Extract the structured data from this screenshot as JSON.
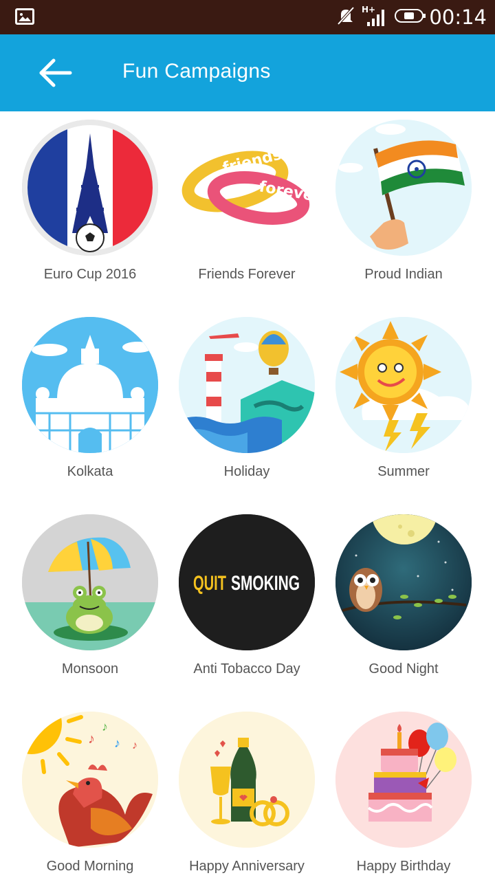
{
  "status_bar": {
    "time": "00:14",
    "network": "H+",
    "icons": [
      "gallery-icon",
      "muted-bell-icon",
      "signal-icon",
      "battery-icon"
    ]
  },
  "app_bar": {
    "title": "Fun Campaigns",
    "back_icon": "arrow-back-icon",
    "color": "#13a3dc"
  },
  "campaigns": [
    {
      "label": "Euro Cup 2016",
      "icon": "eiffel-flag-football-icon"
    },
    {
      "label": "Friends Forever",
      "icon": "friendship-bands-icon"
    },
    {
      "label": "Proud Indian",
      "icon": "indian-flag-icon"
    },
    {
      "label": "Kolkata",
      "icon": "victoria-memorial-icon"
    },
    {
      "label": "Holiday",
      "icon": "lighthouse-map-icon"
    },
    {
      "label": "Summer",
      "icon": "sun-icon"
    },
    {
      "label": "Monsoon",
      "icon": "frog-umbrella-icon"
    },
    {
      "label": "Anti Tobacco Day",
      "icon": "quit-smoking-icon",
      "text_left": "QUIT",
      "text_right": "SMOKING"
    },
    {
      "label": "Good Night",
      "icon": "owl-moon-icon"
    },
    {
      "label": "Good Morning",
      "icon": "rooster-icon"
    },
    {
      "label": "Happy Anniversary",
      "icon": "champagne-rings-icon"
    },
    {
      "label": "Happy Birthday",
      "icon": "cake-balloons-icon"
    }
  ]
}
